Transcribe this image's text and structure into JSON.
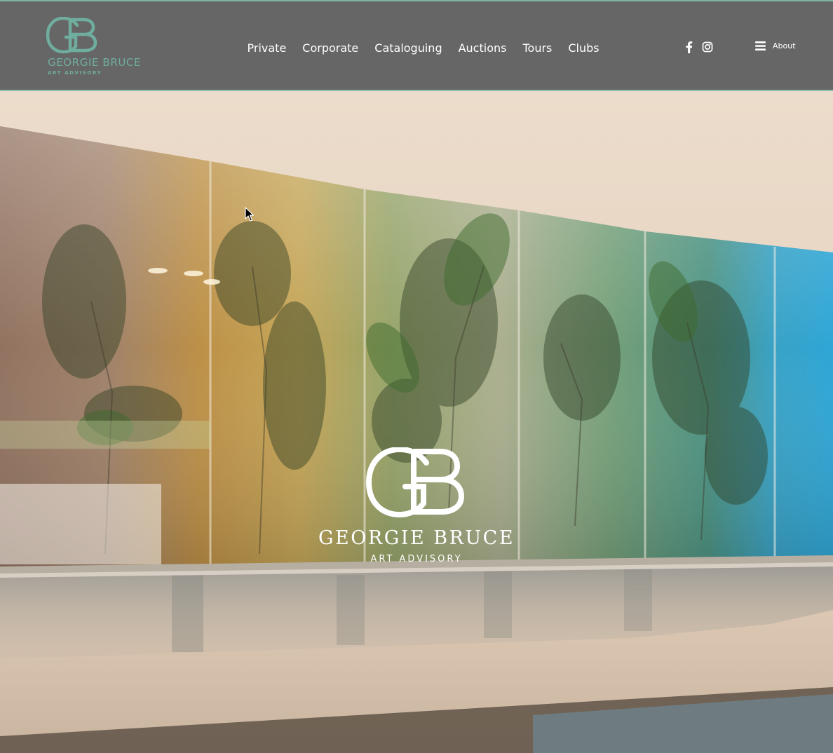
{
  "brand": {
    "name": "GEORGIE BRUCE",
    "tagline": "ART ADVISORY",
    "monogram": "GB",
    "accent_color": "#6fae9f",
    "header_bg": "#666666"
  },
  "nav": {
    "items": [
      {
        "label": "Private"
      },
      {
        "label": "Corporate"
      },
      {
        "label": "Cataloguing"
      },
      {
        "label": "Auctions"
      },
      {
        "label": "Tours"
      },
      {
        "label": "Clubs"
      }
    ]
  },
  "social": {
    "icons": [
      "facebook-icon",
      "instagram-icon"
    ]
  },
  "menu": {
    "label": "About",
    "icon": "hamburger-icon"
  },
  "hero": {
    "brand_name": "GEORGIE BRUCE",
    "brand_tagline": "ART ADVISORY",
    "image": "botanical glass panels artwork"
  }
}
